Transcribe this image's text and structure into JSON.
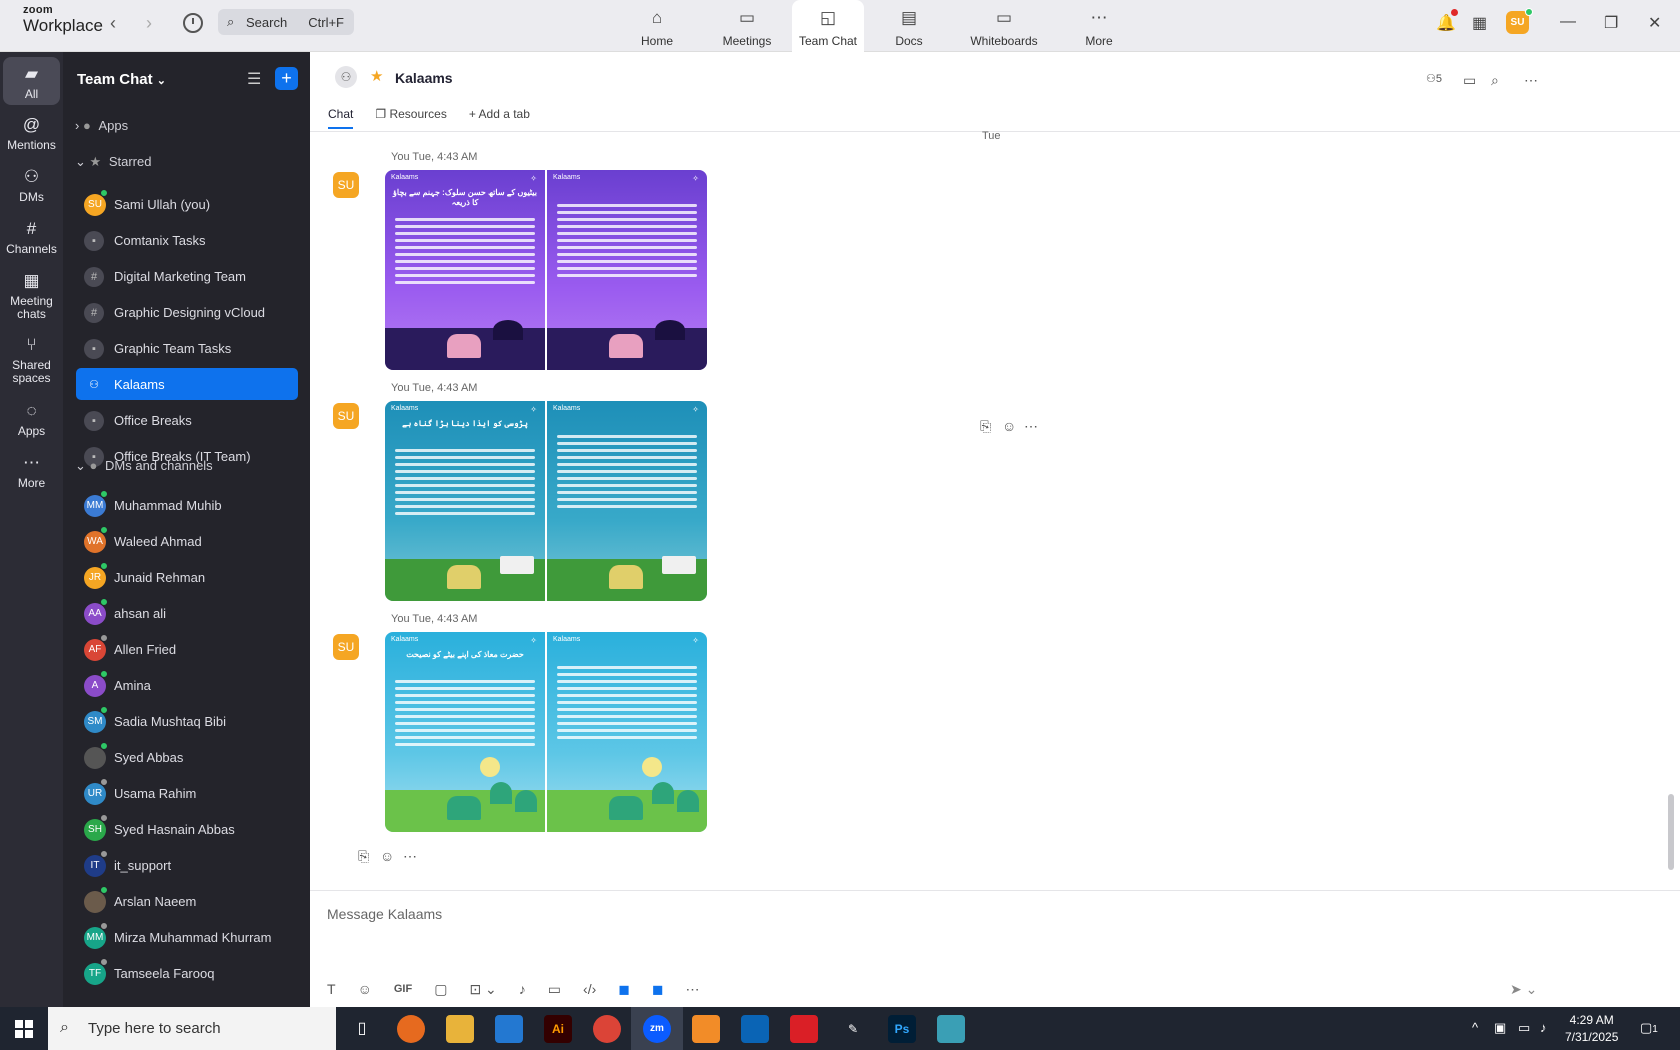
{
  "titlebar": {
    "logo_top": "zoom",
    "logo_bottom": "Workplace",
    "search_label": "Search",
    "search_shortcut": "Ctrl+F",
    "tabs": [
      {
        "label": "Home",
        "icon": "home-icon"
      },
      {
        "label": "Meetings",
        "icon": "video-camera-icon"
      },
      {
        "label": "Team Chat",
        "icon": "chat-bubble-icon"
      },
      {
        "label": "Docs",
        "icon": "document-icon"
      },
      {
        "label": "Whiteboards",
        "icon": "whiteboard-icon"
      },
      {
        "label": "More",
        "icon": "more-dots-icon"
      }
    ],
    "user_initials": "SU"
  },
  "leftbar": {
    "items": [
      {
        "label": "All",
        "icon": "chat-icon"
      },
      {
        "label": "Mentions",
        "icon": "at-icon"
      },
      {
        "label": "DMs",
        "icon": "people-icon"
      },
      {
        "label": "Channels",
        "icon": "hash-icon"
      },
      {
        "label": "Meeting chats",
        "icon": "calendar-icon"
      },
      {
        "label": "Shared spaces",
        "icon": "share-icon"
      },
      {
        "label": "Apps",
        "icon": "apps-icon"
      },
      {
        "label": "More",
        "icon": "more-icon"
      }
    ]
  },
  "sidebar": {
    "title": "Team Chat",
    "apps_label": "Apps",
    "starred_label": "Starred",
    "starred": [
      {
        "label": "Sami Ullah (you)",
        "initials": "SU",
        "color": "#f5a623",
        "kind": "avatar",
        "status": "#2ec866"
      },
      {
        "label": "Comtanix Tasks",
        "kind": "lock"
      },
      {
        "label": "Digital Marketing Team",
        "kind": "hash"
      },
      {
        "label": "Graphic Designing vCloud",
        "kind": "hash"
      },
      {
        "label": "Graphic Team Tasks",
        "kind": "lock"
      },
      {
        "label": "Kalaams",
        "kind": "group",
        "active": true
      },
      {
        "label": "Office Breaks",
        "kind": "lock"
      },
      {
        "label": "Office Breaks (IT Team)",
        "kind": "lock"
      }
    ],
    "dms_label": "DMs and channels",
    "dms": [
      {
        "label": "Muhammad Muhib",
        "initials": "MM",
        "color": "#3b7bd4",
        "status": "#2ec866"
      },
      {
        "label": "Waleed Ahmad",
        "initials": "WA",
        "color": "#e0732a",
        "status": "#2ec866"
      },
      {
        "label": "Junaid Rehman",
        "initials": "JR",
        "color": "#f5a623",
        "status": "#2ec866"
      },
      {
        "label": "ahsan ali",
        "initials": "AA",
        "color": "#8b4cc9",
        "status": "#2ec866"
      },
      {
        "label": "Allen Fried",
        "initials": "AF",
        "color": "#d94636",
        "status": "#999999"
      },
      {
        "label": "Amina",
        "initials": "A",
        "color": "#8b4cc9",
        "status": "#2ec866"
      },
      {
        "label": "Sadia Mushtaq Bibi",
        "initials": "SM",
        "color": "#2f8ac8",
        "status": "#2ec866"
      },
      {
        "label": "Syed Abbas",
        "initials": "",
        "color": "#555555",
        "status": "#2ec866"
      },
      {
        "label": "Usama Rahim",
        "initials": "UR",
        "color": "#2f8ac8",
        "status": "#999999"
      },
      {
        "label": "Syed Hasnain Abbas",
        "initials": "SH",
        "color": "#2aa84a",
        "status": "#999999"
      },
      {
        "label": "it_support",
        "initials": "IT",
        "color": "#1f3c88",
        "status": "#999999"
      },
      {
        "label": "Arslan Naeem",
        "initials": "",
        "color": "#6b5b4b",
        "status": "#2ec866"
      },
      {
        "label": "Mirza Muhammad Khurram",
        "initials": "MM",
        "color": "#17a589",
        "status": "#999999"
      },
      {
        "label": "Tamseela Farooq",
        "initials": "TF",
        "color": "#17a589",
        "status": "#999999"
      }
    ]
  },
  "chat": {
    "title": "Kalaams",
    "member_count": "5",
    "tabs": [
      "Chat",
      "Resources",
      "Add a tab"
    ],
    "day_label": "Tue",
    "messages": [
      {
        "sender": "You",
        "time": "Tue, 4:43 AM",
        "initials": "SU",
        "theme": "purple"
      },
      {
        "sender": "You",
        "time": "Tue, 4:43 AM",
        "initials": "SU",
        "theme": "teal"
      },
      {
        "sender": "You",
        "time": "Tue, 4:43 AM",
        "initials": "SU",
        "theme": "sky"
      }
    ],
    "card_brand": "Kalaams",
    "card_titles": [
      "بیٹیوں کے ساتھ حسن سلوک: جہنم سے بچاؤ کا ذریعہ",
      "پڑوسی کو ایذا دینا بڑا گناہ ہے",
      "حضرت معاذ کی اپنے بیٹے کو نصیحت"
    ],
    "composer_placeholder": "Message Kalaams",
    "composer_gif": "GIF"
  },
  "taskbar": {
    "search_placeholder": "Type here to search",
    "time": "4:29 AM",
    "date": "7/31/2025",
    "notification_count": "1"
  }
}
